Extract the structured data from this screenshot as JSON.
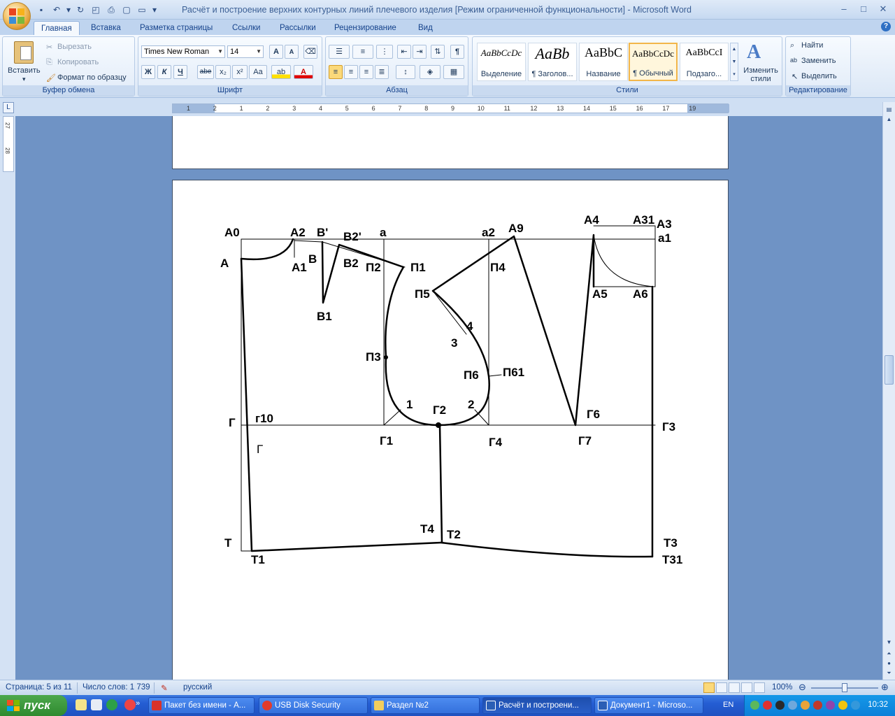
{
  "window": {
    "title": "Расчёт и построение верхних контурных линий плечевого изделия [Режим ограниченной функциональности] - Microsoft Word",
    "minimize": "–",
    "maximize": "□",
    "close": "✕"
  },
  "tabs": [
    {
      "label": "Главная"
    },
    {
      "label": "Вставка"
    },
    {
      "label": "Разметка страницы"
    },
    {
      "label": "Ссылки"
    },
    {
      "label": "Рассылки"
    },
    {
      "label": "Рецензирование"
    },
    {
      "label": "Вид"
    }
  ],
  "ribbon": {
    "clipboard": {
      "label": "Буфер обмена",
      "paste": "Вставить",
      "cut": "Вырезать",
      "copy": "Копировать",
      "format_painter": "Формат по образцу"
    },
    "font": {
      "label": "Шрифт",
      "font_name": "Times New Roman",
      "font_size": "14",
      "bold": "Ж",
      "italic": "К",
      "underline": "Ч",
      "strike": "abe",
      "sub": "x₂",
      "sup": "x²",
      "case": "Aa",
      "grow": "A",
      "shrink": "A"
    },
    "paragraph": {
      "label": "Абзац"
    },
    "styles": {
      "label": "Стили",
      "change": "Изменить стили",
      "items": [
        {
          "sample": "AaBbCcDc",
          "name": "Выделение"
        },
        {
          "sample": "AaBb",
          "name": "¶ Заголов..."
        },
        {
          "sample": "AaBbC",
          "name": "Название"
        },
        {
          "sample": "AaBbCcDc",
          "name": "¶ Обычный"
        },
        {
          "sample": "AaBbCcI",
          "name": "Подзаго..."
        }
      ]
    },
    "editing": {
      "label": "Редактирование",
      "find": "Найти",
      "replace": "Заменить",
      "select": "Выделить"
    }
  },
  "ruler": {
    "numbers": [
      "1",
      "2",
      "1",
      "2",
      "3",
      "4",
      "5",
      "6",
      "7",
      "8",
      "9",
      "10",
      "11",
      "12",
      "13",
      "14",
      "15",
      "16",
      "17",
      "19"
    ],
    "vnumbers": [
      "27",
      "28"
    ]
  },
  "drawing": {
    "labels": [
      "А0",
      "А2",
      "В'",
      "В2'",
      "а",
      "а2",
      "А9",
      "А4",
      "А31",
      "А3",
      "а1",
      "А",
      "В",
      "А1",
      "В2",
      "П2",
      "П1",
      "П4",
      "А5",
      "А6",
      "П5",
      "В1",
      "4",
      "3",
      "П3",
      "П6",
      "П61",
      "1",
      "Г2",
      "2",
      "Г6",
      "Г",
      "г10",
      "Г3",
      "Г1",
      "Г4",
      "Г7",
      "Г",
      "Т4",
      "Т2",
      "Т",
      "Т3",
      "Т1",
      "Т31"
    ]
  },
  "status": {
    "page": "Страница: 5 из 11",
    "words": "Число слов: 1 739",
    "lang": "русский",
    "zoom": "100%"
  },
  "taskbar": {
    "start": "пуск",
    "tasks": [
      {
        "label": "Пакет без имени - А..."
      },
      {
        "label": "USB Disk Security"
      },
      {
        "label": "Раздел №2"
      },
      {
        "label": "Расчёт и построени..."
      },
      {
        "label": "Документ1 - Microso..."
      }
    ],
    "lang": "EN",
    "clock": "10:32"
  }
}
